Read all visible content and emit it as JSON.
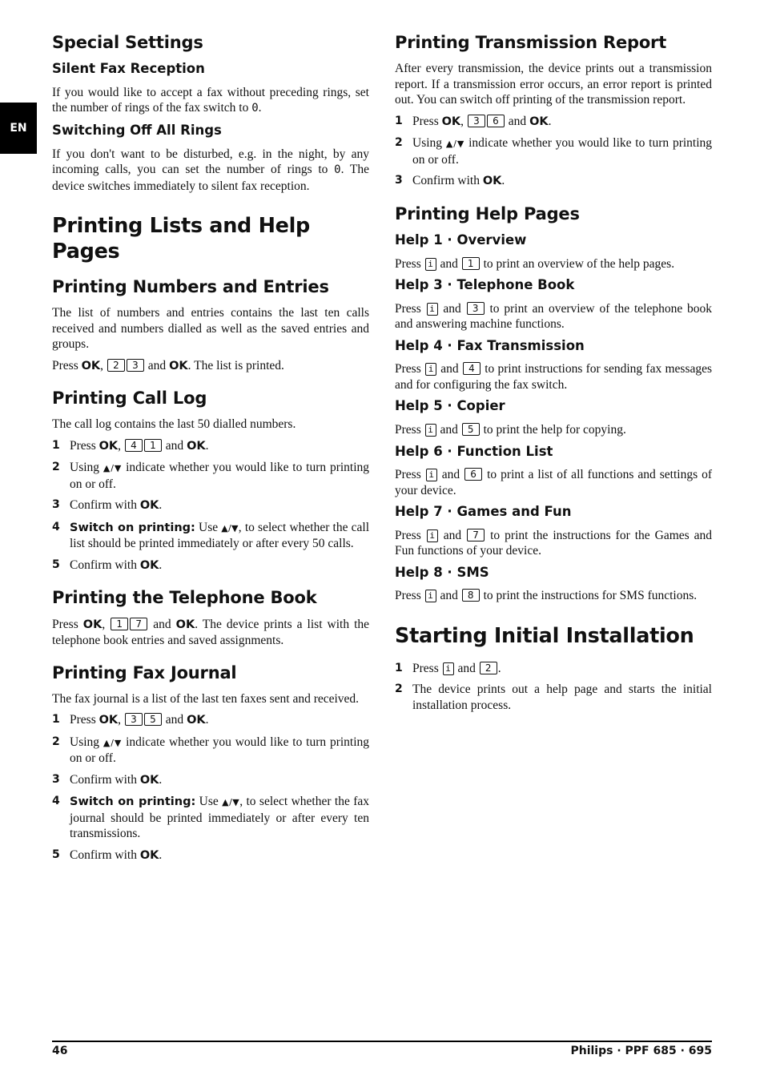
{
  "lang_tab": "EN",
  "left": {
    "special_settings": {
      "title": "Special Settings",
      "silent": {
        "title": "Silent Fax Reception",
        "text_a": "If you would like to accept a fax without preceding rings, set the number of rings of the fax switch to ",
        "zero": "0",
        "text_b": "."
      },
      "rings_off": {
        "title": "Switching Off All Rings",
        "text_a": "If you don't want to be disturbed, e.g. in the night, by any incoming calls, you can set the number of rings to ",
        "zero": "0",
        "text_b": ". The device switches immediately to silent fax reception."
      }
    },
    "lists": {
      "title": "Printing Lists and Help Pages",
      "numbers": {
        "title": "Printing Numbers and Entries",
        "text": "The list of numbers and entries contains the last ten calls received and numbers dialled as well as the saved entries and groups.",
        "press": "Press",
        "ok": "OK",
        "comma": ",",
        "keys": [
          "2",
          "3"
        ],
        "and": "and",
        "tail": ". The list is printed."
      },
      "call_log": {
        "title": "Printing Call Log",
        "text": "The call log contains the last 50 dialled numbers.",
        "steps": [
          {
            "num": "1",
            "press": "Press",
            "ok": "OK",
            "keys": [
              "4",
              "1"
            ],
            "and": "and",
            "ok2": "OK",
            "end": "."
          },
          {
            "num": "2",
            "a": "Using",
            "arrows": "▲/▼",
            "b": "indicate whether you would like to turn printing on or off."
          },
          {
            "num": "3",
            "a": "Confirm with",
            "ok": "OK",
            "end": "."
          },
          {
            "num": "4",
            "bold": "Switch on printing:",
            "a": "Use",
            "arrows": "▲/▼",
            "b": ", to select whether the call list should be printed immediately or after every 50 calls."
          },
          {
            "num": "5",
            "a": "Confirm with",
            "ok": "OK",
            "end": "."
          }
        ]
      },
      "phonebook": {
        "title": "Printing the Telephone Book",
        "press": "Press",
        "ok": "OK",
        "keys": [
          "1",
          "7"
        ],
        "and": "and",
        "tail": ". The device prints a list with the telephone book entries and saved assignments."
      },
      "fax_journal": {
        "title": "Printing Fax Journal",
        "text": "The fax journal is a list of the last ten faxes sent and received.",
        "steps": [
          {
            "num": "1",
            "press": "Press",
            "ok": "OK",
            "keys": [
              "3",
              "5"
            ],
            "and": "and",
            "ok2": "OK",
            "end": "."
          },
          {
            "num": "2",
            "a": "Using",
            "arrows": "▲/▼",
            "b": "indicate whether you would like to turn printing on or off."
          },
          {
            "num": "3",
            "a": "Confirm with",
            "ok": "OK",
            "end": "."
          },
          {
            "num": "4",
            "bold": "Switch on printing:",
            "a": "Use",
            "arrows": "▲/▼",
            "b": ", to select whether the fax journal should be printed immediately or after every ten transmissions."
          },
          {
            "num": "5",
            "a": "Confirm with",
            "ok": "OK",
            "end": "."
          }
        ]
      }
    }
  },
  "right": {
    "transmission_report": {
      "title": "Printing Transmission Report",
      "text": "After every transmission, the device prints out a transmission report. If a transmission error occurs, an error report is printed out. You can switch off printing of the transmission report.",
      "steps": [
        {
          "num": "1",
          "press": "Press",
          "ok": "OK",
          "keys": [
            "3",
            "6"
          ],
          "and": "and",
          "ok2": "OK",
          "end": "."
        },
        {
          "num": "2",
          "a": "Using",
          "arrows": "▲/▼",
          "b": "indicate whether you would like to turn printing on or off."
        },
        {
          "num": "3",
          "a": "Confirm with",
          "ok": "OK",
          "end": "."
        }
      ]
    },
    "help_pages": {
      "title": "Printing Help Pages",
      "info_key": "i",
      "items": [
        {
          "title": "Help 1 · Overview",
          "press": "Press",
          "key": "1",
          "and": "and",
          "text": "to print an overview of the help pages."
        },
        {
          "title": "Help 3 · Telephone Book",
          "press": "Press",
          "key": "3",
          "and": "and",
          "text": "to print an overview of the telephone book and answering machine functions."
        },
        {
          "title": "Help 4 · Fax Transmission",
          "press": "Press",
          "key": "4",
          "and": "and",
          "text": "to print instructions for sending fax messages and for configuring the fax switch."
        },
        {
          "title": "Help 5 · Copier",
          "press": "Press",
          "key": "5",
          "and": "and",
          "text": "to print the help for copying."
        },
        {
          "title": "Help 6 · Function List",
          "press": "Press",
          "key": "6",
          "and": "and",
          "text": "to print a list of all functions and settings of your device."
        },
        {
          "title": "Help 7 · Games and Fun",
          "press": "Press",
          "key": "7",
          "and": "and",
          "text": "to print the instructions for the Games and Fun functions of your device."
        },
        {
          "title": "Help 8 · SMS",
          "press": "Press",
          "key": "8",
          "and": "and",
          "text": "to print the instructions for SMS functions."
        }
      ]
    },
    "initial_install": {
      "title": "Starting Initial Installation",
      "steps": [
        {
          "num": "1",
          "press": "Press",
          "key_i": "i",
          "and": "and",
          "key": "2",
          "end": "."
        },
        {
          "num": "2",
          "text": "The device prints out a help page and starts the initial installation process."
        }
      ]
    }
  },
  "footer": {
    "page_number": "46",
    "product": "Philips · PPF 685 · 695"
  }
}
